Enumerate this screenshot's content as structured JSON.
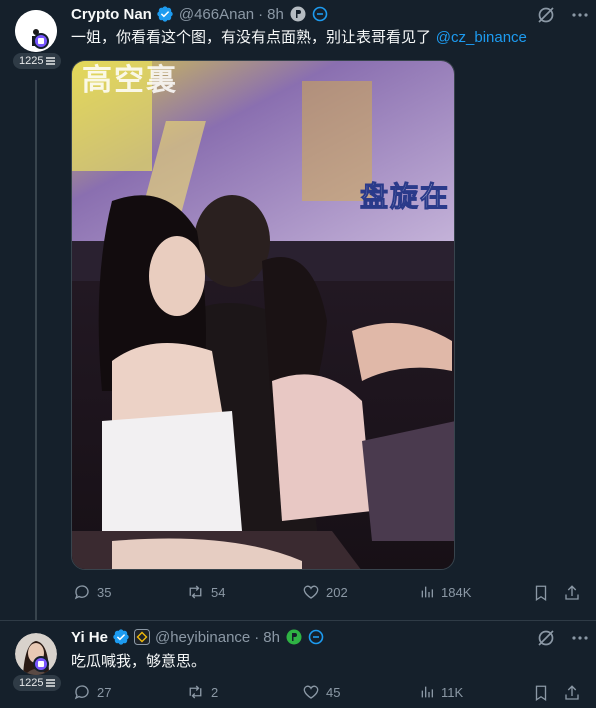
{
  "tweet1": {
    "author_name": "Crypto Nan",
    "handle": "@466Anan",
    "separator": "·",
    "time": "8h",
    "follower_badge": "1225",
    "text": "一姐，你看看这个图，有没有点面熟，别让表哥看见了 ",
    "mention": "@cz_binance",
    "image_caption_top": "高空裏",
    "image_caption_right": "盘旋在",
    "stats": {
      "replies": "35",
      "reposts": "54",
      "likes": "202",
      "views": "184K"
    }
  },
  "tweet2": {
    "author_name": "Yi He",
    "handle": "@heyibinance",
    "separator": "·",
    "time": "8h",
    "follower_badge": "1225",
    "text": "吃瓜喊我，够意思。",
    "stats": {
      "replies": "27",
      "reposts": "2",
      "likes": "45",
      "views": "11K"
    }
  },
  "colors": {
    "background": "#15202b",
    "text": "#f7f9f9",
    "muted": "#8b98a5",
    "accent": "#1d9bf0",
    "verified": "#1d9bf0",
    "badge_purple": "#7856ff"
  },
  "icons": [
    "grok-icon",
    "more-icon",
    "reply-icon",
    "repost-icon",
    "like-icon",
    "views-icon",
    "bookmark-icon",
    "share-icon",
    "verified-icon",
    "circle-p-icon"
  ]
}
